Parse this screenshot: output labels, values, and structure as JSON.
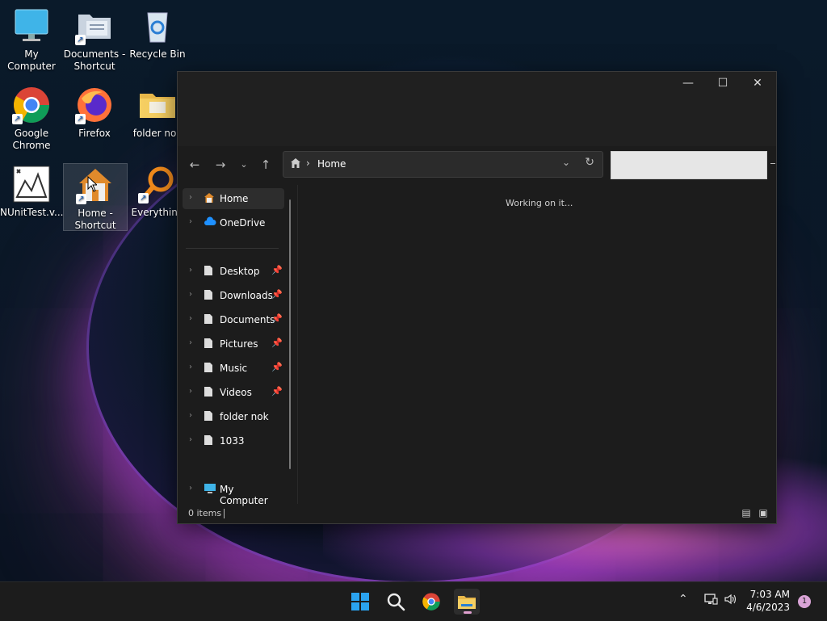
{
  "desktop": {
    "icons": [
      {
        "label": "My Computer",
        "icon": "monitor-icon"
      },
      {
        "label": "Documents - Shortcut",
        "icon": "documents-folder-icon"
      },
      {
        "label": "Recycle Bin",
        "icon": "recycle-bin-icon"
      },
      {
        "label": "Google Chrome",
        "icon": "chrome-icon"
      },
      {
        "label": "Firefox",
        "icon": "firefox-icon"
      },
      {
        "label": "folder nok",
        "icon": "folder-icon"
      },
      {
        "label": "NUnitTest.v...",
        "icon": "nunit-icon"
      },
      {
        "label": "Home - Shortcut",
        "icon": "home-icon"
      },
      {
        "label": "Everything",
        "icon": "everything-search-icon"
      }
    ]
  },
  "explorer": {
    "address": {
      "crumb": "Home",
      "separator": "›"
    },
    "sidebar": {
      "items": [
        {
          "label": "Home",
          "pinned": false
        },
        {
          "label": "OneDrive",
          "pinned": false
        },
        {
          "label": "Desktop",
          "pinned": true
        },
        {
          "label": "Downloads",
          "pinned": true
        },
        {
          "label": "Documents",
          "pinned": true
        },
        {
          "label": "Pictures",
          "pinned": true
        },
        {
          "label": "Music",
          "pinned": true
        },
        {
          "label": "Videos",
          "pinned": true
        },
        {
          "label": "folder nok",
          "pinned": false
        },
        {
          "label": "1033",
          "pinned": false
        },
        {
          "label": "My Computer",
          "pinned": false
        }
      ]
    },
    "content": {
      "message": "Working on it..."
    },
    "status": {
      "count": "0 items"
    }
  },
  "taskbar": {
    "clock": {
      "time": "7:03 AM",
      "date": "4/6/2023"
    },
    "notification_count": "1"
  },
  "colors": {
    "accent": "#0078d4",
    "notif_badge": "#d9a3d6"
  }
}
